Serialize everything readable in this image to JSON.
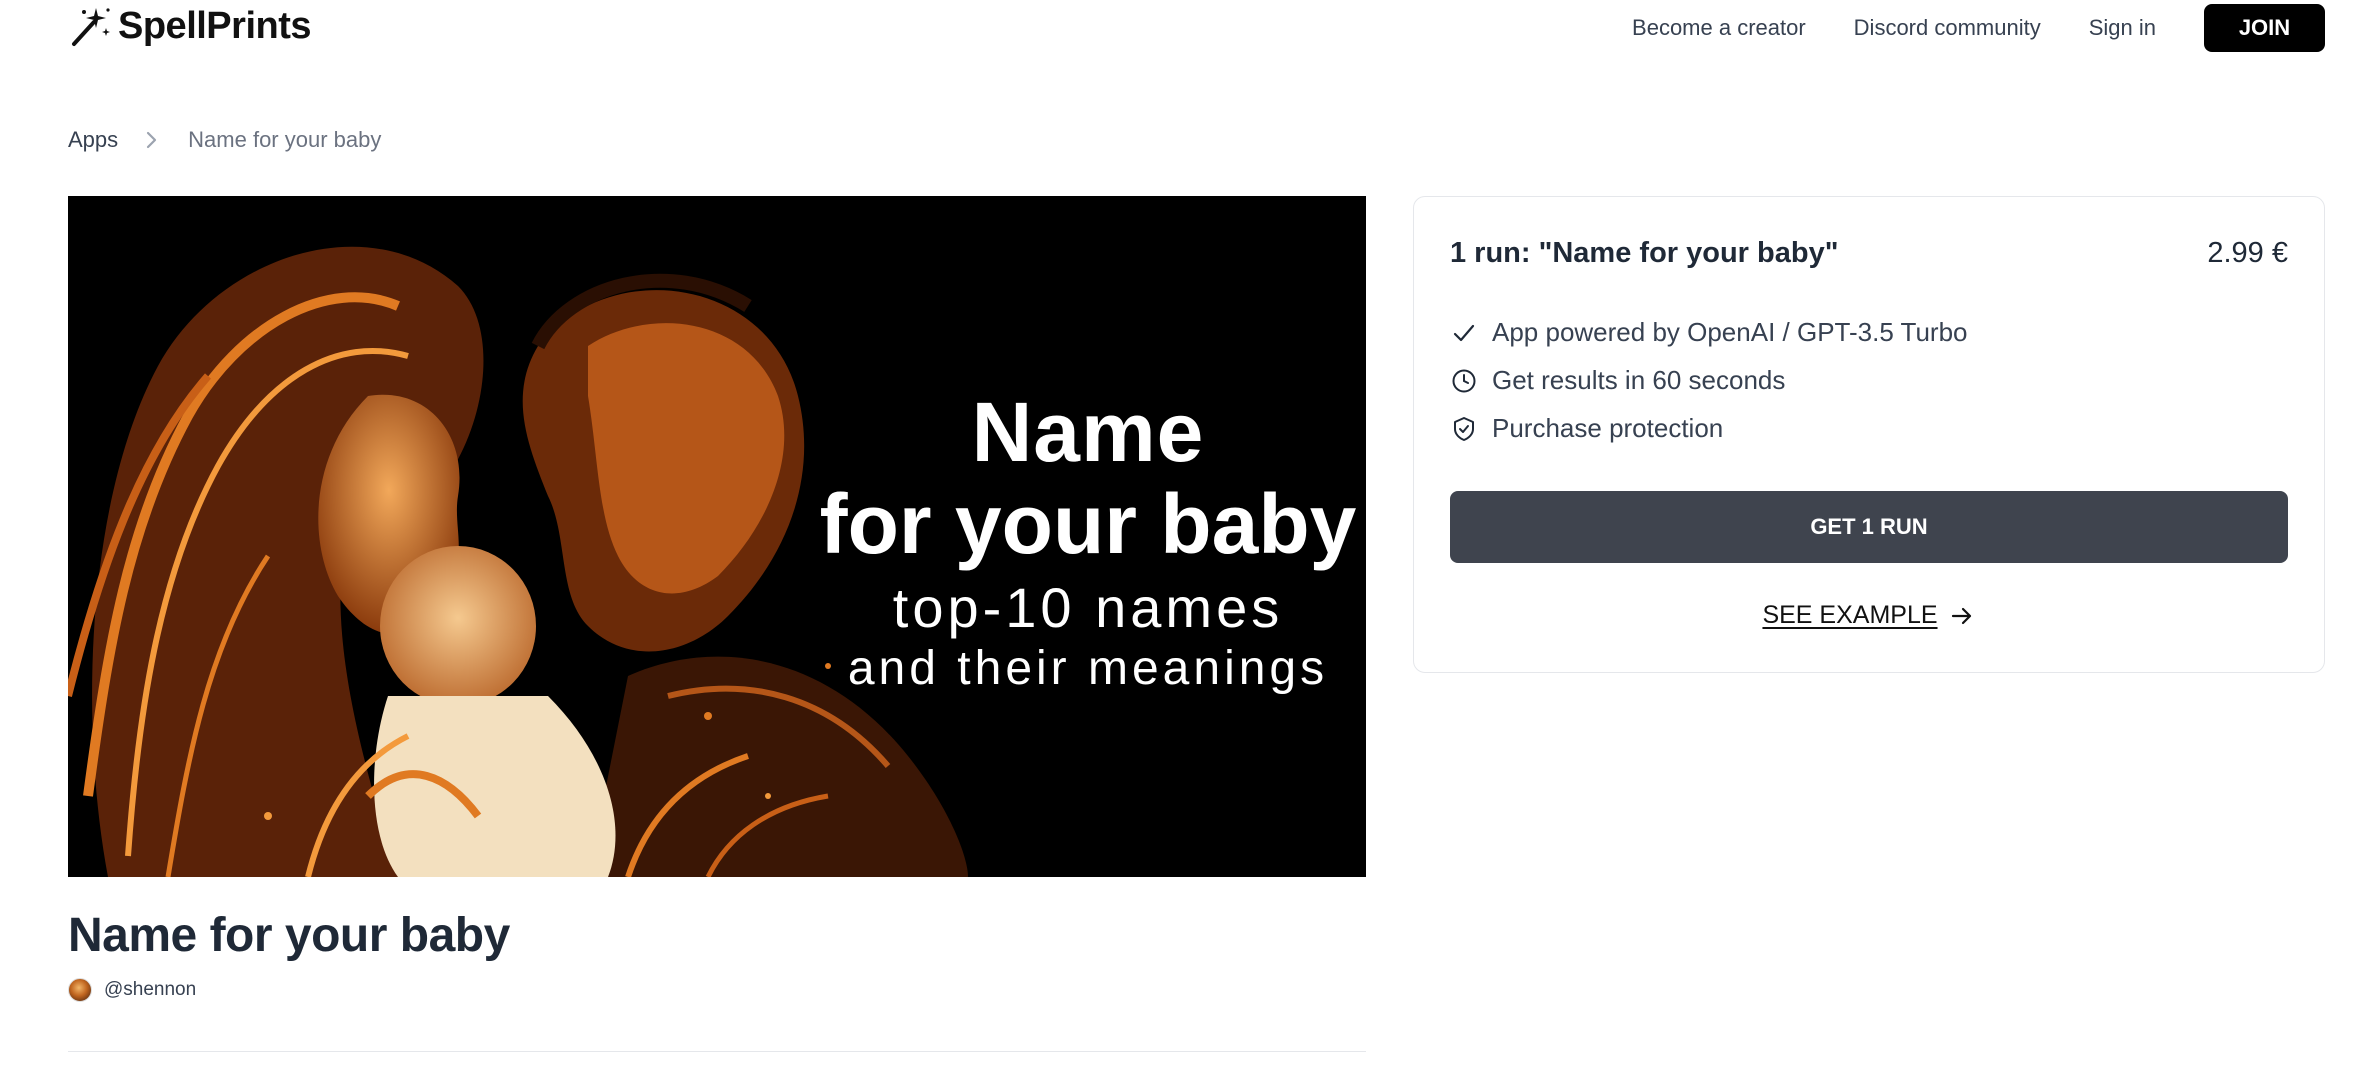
{
  "header": {
    "logo_text": "SpellPrints",
    "logo_icon": "magic-wand-icon",
    "nav": [
      "Become a creator",
      "Discord community",
      "Sign in"
    ],
    "join_label": "JOIN"
  },
  "breadcrumb": {
    "root": "Apps",
    "current": "Name for your baby",
    "separator_icon": "chevron-right-icon"
  },
  "hero": {
    "line1": "Name",
    "line2": "for your baby",
    "line3": "top-10 names",
    "line4": "and their meanings"
  },
  "app": {
    "title": "Name for your baby",
    "author": "@shennon"
  },
  "purchase": {
    "title": "1 run: \"Name for your baby\"",
    "price": "2.99 €",
    "features": [
      {
        "icon": "check-icon",
        "text": "App powered by OpenAI / GPT-3.5 Turbo"
      },
      {
        "icon": "clock-icon",
        "text": "Get results in 60 seconds"
      },
      {
        "icon": "shield-check-icon",
        "text": "Purchase protection"
      }
    ],
    "button_label": "GET 1 RUN",
    "example_label": "SEE EXAMPLE",
    "example_icon": "arrow-right-icon"
  },
  "colors": {
    "button_dark": "#3f444e",
    "join_bg": "#000000",
    "hero_bg": "#000000",
    "hero_accent": "#e07a22"
  }
}
